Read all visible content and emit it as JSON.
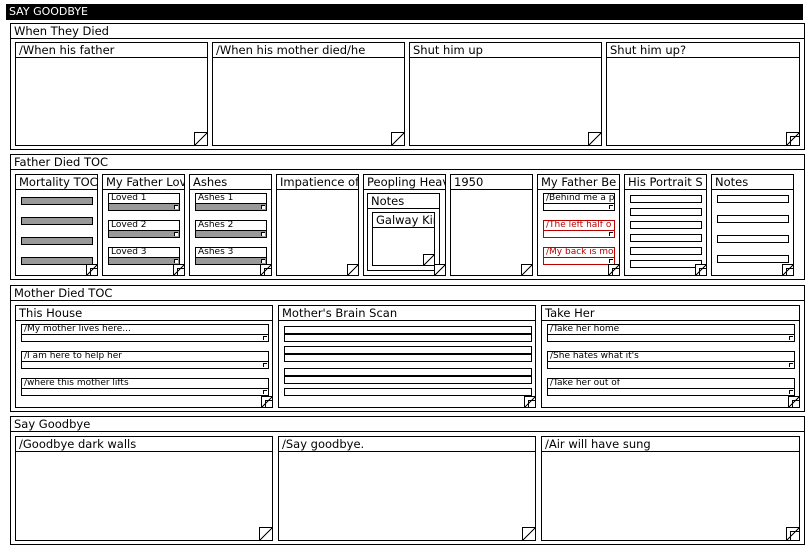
{
  "app": {
    "title": "SAY GOODBYE"
  },
  "sections": {
    "when": {
      "title": "When They Died",
      "notes": [
        "/When his father",
        "/When his mother died/he",
        "Shut him up",
        "Shut him up?"
      ]
    },
    "father": {
      "title": "Father Died TOC",
      "mortality": {
        "title": "Mortality TOC"
      },
      "my_father_loved": {
        "title": "My Father Loved",
        "items": [
          "Loved 1",
          "Loved 2",
          "Loved 3"
        ]
      },
      "ashes": {
        "title": "Ashes",
        "items": [
          "Ashes 1",
          "Ashes 2",
          "Ashes 3"
        ]
      },
      "impatience": {
        "title": "Impatience of"
      },
      "peopling": {
        "title": "Peopling Heaven",
        "notes_title": "Notes",
        "galway_title": "Galway Kinnell"
      },
      "y1950": {
        "title": "1950"
      },
      "my_father_be": {
        "title": "My Father Be",
        "items": [
          "/Behind me a po",
          "/The left half o",
          "/My back is mo"
        ]
      },
      "portrait": {
        "title": "His Portrait S"
      },
      "notes": {
        "title": "Notes"
      }
    },
    "mother": {
      "title": "Mother Died TOC",
      "this_house": {
        "title": "This House",
        "items": [
          "/My mother lives here...",
          "/I am here to help her",
          "/where this mother lifts"
        ]
      },
      "brain_scan": {
        "title": "Mother's Brain Scan"
      },
      "take_her": {
        "title": "Take Her",
        "items": [
          "/Take her home",
          "/She hates what it's",
          "/Take her out of"
        ]
      }
    },
    "say": {
      "title": "Say Goodbye",
      "notes": [
        "/Goodbye dark walls",
        "/Say goodbye.",
        "/Air will have sung"
      ]
    }
  }
}
